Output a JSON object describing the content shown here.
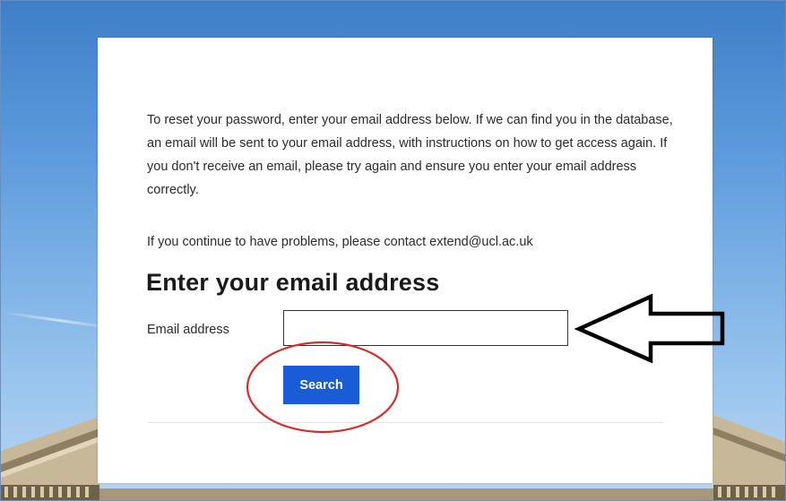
{
  "page": {
    "intro_text": "To reset your password, enter your email address below. If we can find you in the database, an email will be sent to your email address, with instructions on how to get access again. If you don't receive an email, please try again and ensure you enter your email address correctly.",
    "contact_text": "If you continue to have problems, please contact extend@ucl.ac.uk",
    "heading": "Enter your email address"
  },
  "form": {
    "email_label": "Email address",
    "email_value": "",
    "search_label": "Search"
  },
  "colors": {
    "button": "#1a5bd6",
    "annotation_circle": "#d32f2f",
    "annotation_arrow": "#000000",
    "sky": "#5a98db"
  },
  "icons": {
    "annotation_arrow": "left-arrow-outline",
    "annotation_circle": "ellipse-highlight"
  }
}
